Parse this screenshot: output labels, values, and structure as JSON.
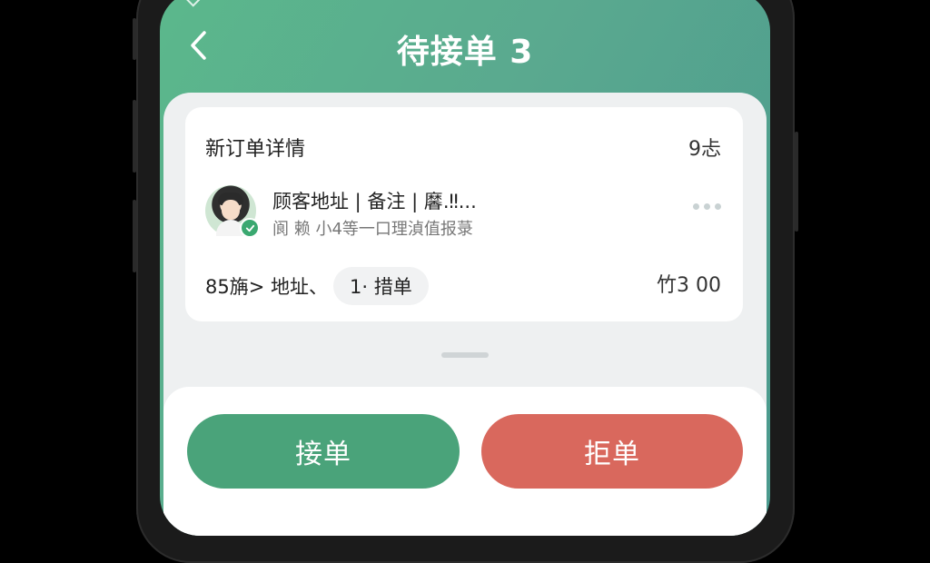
{
  "header": {
    "title": "待接单 3"
  },
  "order": {
    "card_title": "新订单详情",
    "time": "9忐",
    "customer_line": "顾客地址 | 备注 | 黁.‼...",
    "customer_sub": "阆 赖 小4等一口理湞值报菉",
    "route_text": "85㫋> 地址、",
    "route_chip": "1· 措单",
    "price": "竹3 00"
  },
  "actions": {
    "accept_label": "接单",
    "reject_label": "拒单"
  },
  "colors": {
    "header_gradient_start": "#5bb88c",
    "header_gradient_end": "#4a998e",
    "accept": "#4aa37a",
    "reject": "#d9685d"
  },
  "icons": {
    "back": "chevron-left-icon",
    "more": "more-dots-icon",
    "verified": "check-badge-icon"
  }
}
